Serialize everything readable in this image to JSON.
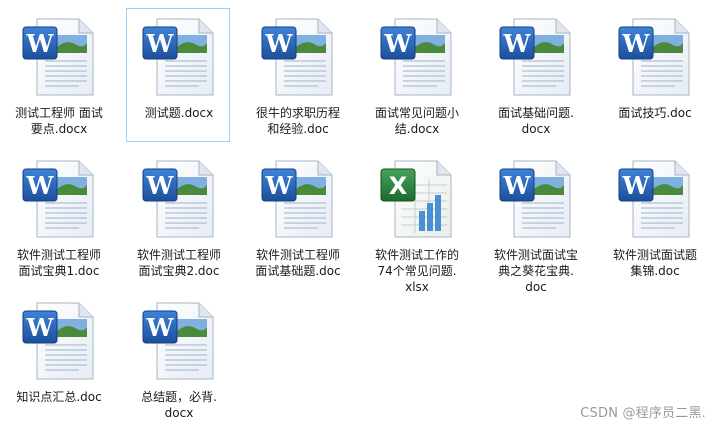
{
  "files": [
    {
      "label": "测试工程师 面试\n要点.docx",
      "type": "word",
      "selected": false
    },
    {
      "label": "测试题.docx",
      "type": "word",
      "selected": true
    },
    {
      "label": "很牛的求职历程\n和经验.doc",
      "type": "word",
      "selected": false
    },
    {
      "label": "面试常见问题小\n结.docx",
      "type": "word",
      "selected": false
    },
    {
      "label": "面试基础问题.\ndocx",
      "type": "word",
      "selected": false
    },
    {
      "label": "面试技巧.doc",
      "type": "word",
      "selected": false
    },
    {
      "label": "软件测试工程师\n面试宝典1.doc",
      "type": "word",
      "selected": false
    },
    {
      "label": "软件测试工程师\n面试宝典2.doc",
      "type": "word",
      "selected": false
    },
    {
      "label": "软件测试工程师\n面试基础题.doc",
      "type": "word",
      "selected": false
    },
    {
      "label": "软件测试工作的\n74个常见问题.\nxlsx",
      "type": "excel",
      "selected": false
    },
    {
      "label": "软件测试面试宝\n典之葵花宝典.\ndoc",
      "type": "word",
      "selected": false
    },
    {
      "label": "软件测试面试题\n集锦.doc",
      "type": "word",
      "selected": false
    },
    {
      "label": "知识点汇总.doc",
      "type": "word",
      "selected": false
    },
    {
      "label": "总结题，必背.\ndocx",
      "type": "word",
      "selected": false
    }
  ],
  "watermark": "CSDN @程序员二黑.",
  "colors": {
    "word": "#1e5fb3",
    "excel": "#1f7a3a",
    "selection_border": "#99d1ff"
  }
}
